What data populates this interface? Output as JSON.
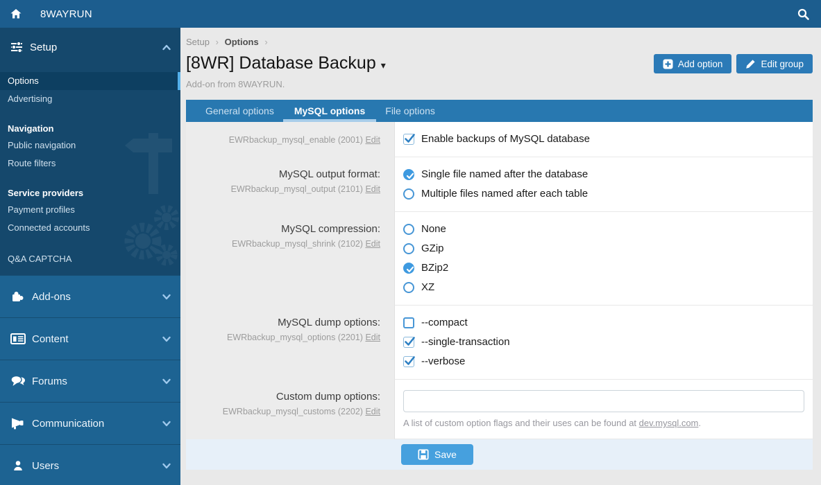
{
  "topbar": {
    "title": "8WAYRUN"
  },
  "sidebar": {
    "setup_label": "Setup",
    "submenu_items": [
      {
        "label": "Options",
        "selected": true
      },
      {
        "label": "Advertising",
        "selected": false
      }
    ],
    "groups": [
      {
        "header": "Navigation",
        "items": [
          {
            "label": "Public navigation"
          },
          {
            "label": "Route filters"
          }
        ]
      },
      {
        "header": "Service providers",
        "items": [
          {
            "label": "Payment profiles"
          },
          {
            "label": "Connected accounts"
          }
        ]
      }
    ],
    "captcha_label": "Q&A CAPTCHA",
    "sections": [
      {
        "label": "Add-ons"
      },
      {
        "label": "Content"
      },
      {
        "label": "Forums"
      },
      {
        "label": "Communication"
      },
      {
        "label": "Users"
      }
    ]
  },
  "main": {
    "breadcrumb": {
      "level1": "Setup",
      "level2": "Options",
      "separator": "›"
    },
    "page_title": "[8WR] Database Backup",
    "title_caret": "▾",
    "subtitle": "Add-on from 8WAYRUN.",
    "add_option_label": "Add option",
    "edit_group_label": "Edit group",
    "tabs": [
      {
        "label": "General options",
        "active": false
      },
      {
        "label": "MySQL options",
        "active": true
      },
      {
        "label": "File options",
        "active": false
      }
    ],
    "rows": [
      {
        "code": "EWRbackup_mysql_enable (2001)",
        "edit": "Edit",
        "options": [
          {
            "label": "Enable backups of MySQL database",
            "checked": true
          }
        ]
      },
      {
        "label": "MySQL output format:",
        "code": "EWRbackup_mysql_output (2101)",
        "edit": "Edit",
        "options": [
          {
            "label": "Single file named after the database",
            "checked": true
          },
          {
            "label": "Multiple files named after each table",
            "checked": false
          }
        ]
      },
      {
        "label": "MySQL compression:",
        "code": "EWRbackup_mysql_shrink (2102)",
        "edit": "Edit",
        "options": [
          {
            "label": "None",
            "checked": false
          },
          {
            "label": "GZip",
            "checked": false
          },
          {
            "label": "BZip2",
            "checked": true
          },
          {
            "label": "XZ",
            "checked": false
          }
        ]
      },
      {
        "label": "MySQL dump options:",
        "code": "EWRbackup_mysql_options (2201)",
        "edit": "Edit",
        "options": [
          {
            "label": "--compact",
            "checked": false
          },
          {
            "label": "--single-transaction",
            "checked": true
          },
          {
            "label": "--verbose",
            "checked": true
          }
        ]
      },
      {
        "label": "Custom dump options:",
        "code": "EWRbackup_mysql_customs (2202)",
        "edit": "Edit",
        "input_value": "",
        "hint_prefix": "A list of custom option flags and their uses can be found at ",
        "hint_link": "dev.mysql.com",
        "hint_suffix": "."
      }
    ],
    "save_label": "Save"
  },
  "icons": {
    "home": "house glyph",
    "search": "magnifier",
    "setup": "sliders",
    "add_ons": "puzzle-piece",
    "content": "newspaper",
    "forums": "chat-bubbles",
    "communication": "megaphone",
    "users": "person",
    "add_option": "plus-square",
    "edit_group": "pencil",
    "save": "floppy-disk",
    "watermarks": "signpost, gears"
  },
  "colors": {
    "topbar": "#1c5d8e",
    "sidebar": "#1d6392",
    "sidebar_expanded": "#15486c",
    "selected_item": "#0d3f61",
    "selected_indicator": "#55b0ea",
    "tabbar": "#2878b0",
    "tab_underline": "#a8cdea",
    "header_button": "#2b7ab7",
    "save_button": "#46a0de",
    "save_row_bg": "#e7f0f9",
    "control_accent": "#3e9ae0",
    "label_column_bg": "#ececec",
    "page_bg": "#e9e9e9"
  }
}
